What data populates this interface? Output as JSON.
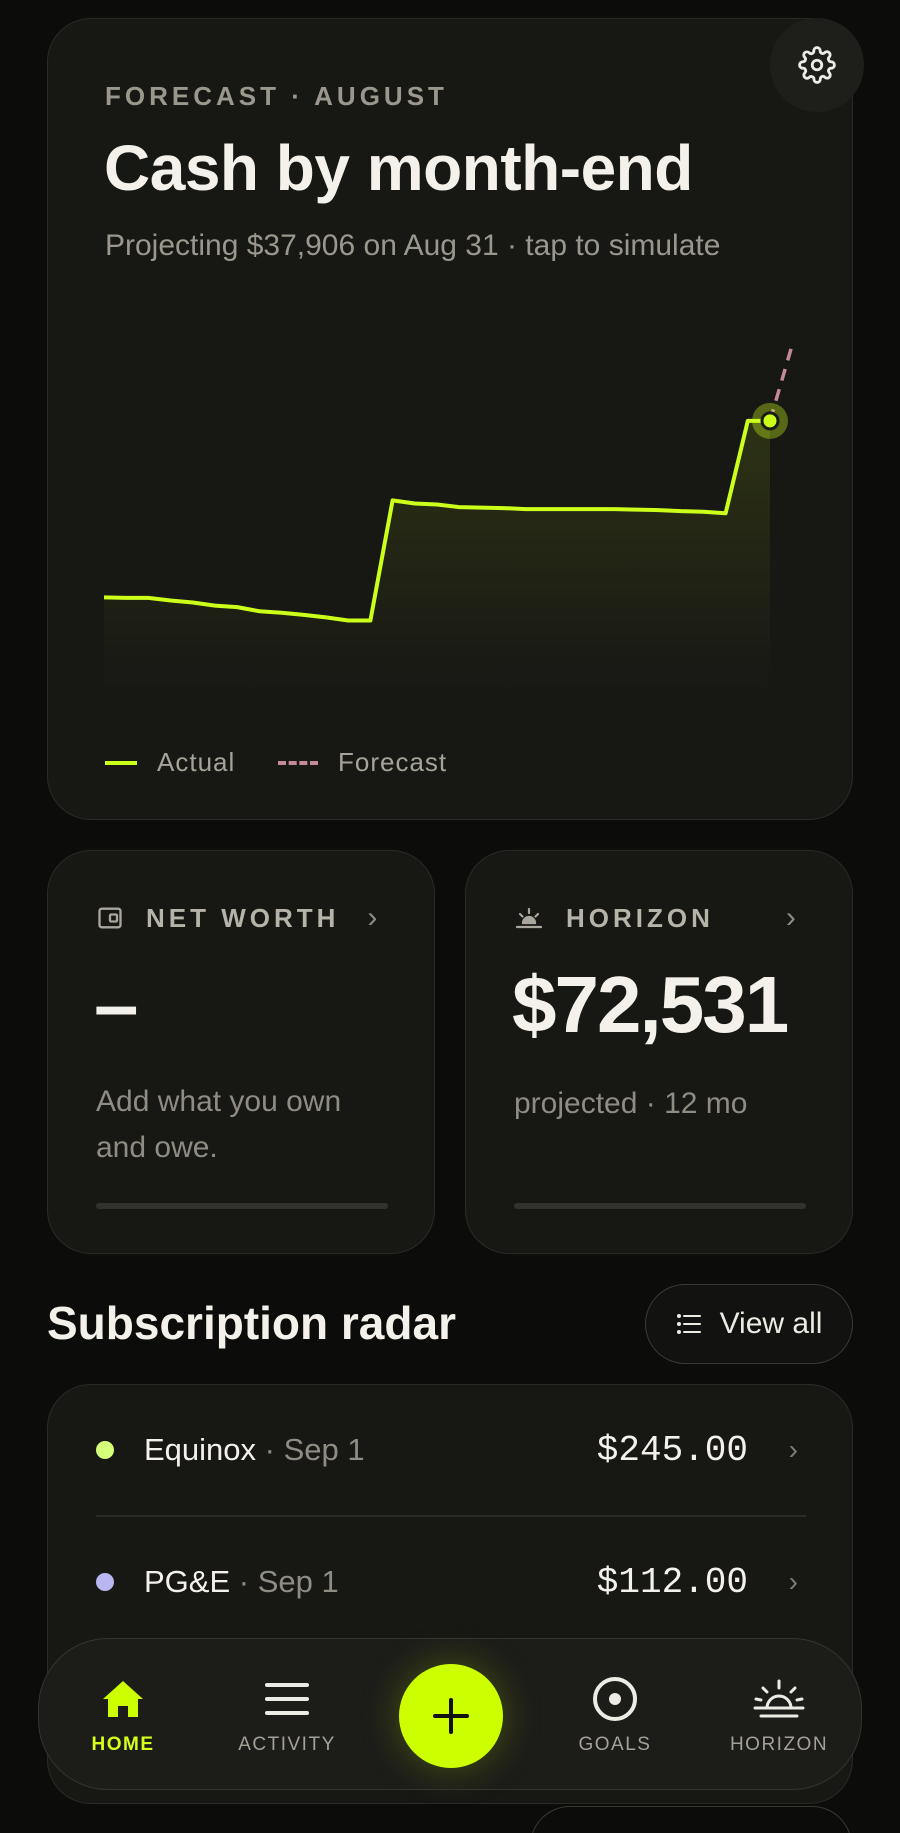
{
  "forecast": {
    "eyebrow": "FORECAST · AUGUST",
    "title": "Cash by month-end",
    "subtitle": "Projecting $37,906 on Aug 31 · tap to simulate",
    "legend": [
      {
        "label": "Actual",
        "color": "#ccff1a",
        "style": "solid"
      },
      {
        "label": "Forecast",
        "color": "#c58a99",
        "style": "dashed"
      }
    ]
  },
  "chart_data": {
    "type": "line",
    "title": "Cash by month-end",
    "xlabel": "",
    "ylabel": "",
    "x_range_days": [
      1,
      31
    ],
    "series": [
      {
        "name": "Actual",
        "color": "#ccff1a",
        "style": "solid",
        "x": [
          1,
          2,
          3,
          4,
          5,
          6,
          7,
          8,
          9,
          10,
          11,
          12,
          13,
          14,
          15,
          16,
          17,
          18,
          19,
          20,
          21,
          22,
          23,
          24,
          25,
          26,
          27,
          28,
          29,
          30,
          31
        ],
        "y": [
          19900,
          19850,
          19850,
          19600,
          19400,
          19100,
          18950,
          18550,
          18400,
          18200,
          17950,
          17650,
          17650,
          29350,
          29050,
          28950,
          28700,
          28650,
          28600,
          28500,
          28500,
          28500,
          28500,
          28500,
          28450,
          28400,
          28300,
          28250,
          28100,
          37100,
          37100
        ]
      },
      {
        "name": "Forecast",
        "color": "#c58a99",
        "style": "dashed",
        "x": [
          31,
          32
        ],
        "y": [
          37100,
          44500
        ]
      }
    ]
  },
  "settings": {
    "icon": "gear-icon"
  },
  "net_worth": {
    "label": "NET WORTH",
    "value": "–",
    "note_line1": "Add what you own",
    "note_line2": "and owe."
  },
  "horizon": {
    "label": "HORIZON",
    "value": "$72,531",
    "note": "projected · 12 mo"
  },
  "subscriptions": {
    "title": "Subscription radar",
    "view_all": "View all",
    "items": [
      {
        "name": "Equinox",
        "date": " · Sep 1",
        "amount": "$245.00",
        "color": "#d6ff7a"
      },
      {
        "name": "PG&E",
        "date": " · Sep 1",
        "amount": "$112.00",
        "color": "#b9b6f2"
      }
    ]
  },
  "nav": {
    "home": "HOME",
    "activity": "ACTIVITY",
    "goals": "GOALS",
    "horizon": "HORIZON",
    "accent": "#ccff00"
  }
}
